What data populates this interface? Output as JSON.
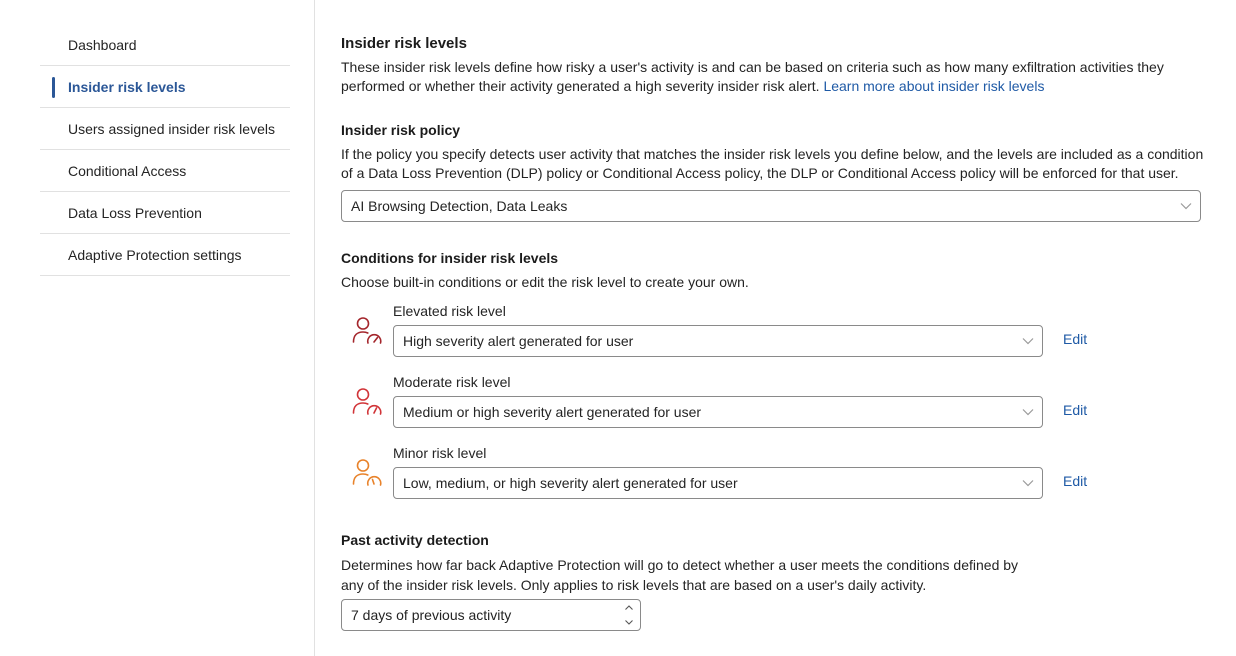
{
  "sidebar": {
    "items": [
      {
        "label": "Dashboard",
        "active": false
      },
      {
        "label": "Insider risk levels",
        "active": true
      },
      {
        "label": "Users assigned insider risk levels",
        "active": false
      },
      {
        "label": "Conditional Access",
        "active": false
      },
      {
        "label": "Data Loss Prevention",
        "active": false
      },
      {
        "label": "Adaptive Protection settings",
        "active": false
      }
    ]
  },
  "main": {
    "title": "Insider risk levels",
    "description": "These insider risk levels define how risky a user's activity is and can be based on criteria such as how many exfiltration activities they performed or whether their activity generated a high severity insider risk alert.",
    "learn_more": "Learn more about insider risk levels",
    "policy": {
      "heading": "Insider risk policy",
      "description": "If the policy you specify detects user activity that matches the insider risk levels you define below, and the levels are included as a condition of a Data Loss Prevention (DLP) policy or Conditional Access policy, the DLP or Conditional Access policy will be enforced for that user.",
      "selected": "AI Browsing Detection, Data Leaks"
    },
    "conditions": {
      "heading": "Conditions for insider risk levels",
      "description": "Choose built-in conditions or edit the risk level to create your own.",
      "levels": [
        {
          "label": "Elevated risk level",
          "value": "High severity alert generated for user",
          "edit": "Edit",
          "icon": "user-risk-elevated-icon",
          "color": "#a4262c"
        },
        {
          "label": "Moderate risk level",
          "value": "Medium or high severity alert generated for user",
          "edit": "Edit",
          "icon": "user-risk-moderate-icon",
          "color": "#d13438"
        },
        {
          "label": "Minor risk level",
          "value": "Low, medium, or high severity alert generated for user",
          "edit": "Edit",
          "icon": "user-risk-minor-icon",
          "color": "#e8822a"
        }
      ]
    },
    "past_activity": {
      "heading": "Past activity detection",
      "description": "Determines how far back Adaptive Protection will go to detect whether a user meets the conditions defined by any of the insider risk levels. Only applies to risk levels that are based on a user's daily activity.",
      "value": "7 days of previous activity"
    }
  },
  "colors": {
    "accent": "#2b5797",
    "link": "#1f5aa6"
  }
}
